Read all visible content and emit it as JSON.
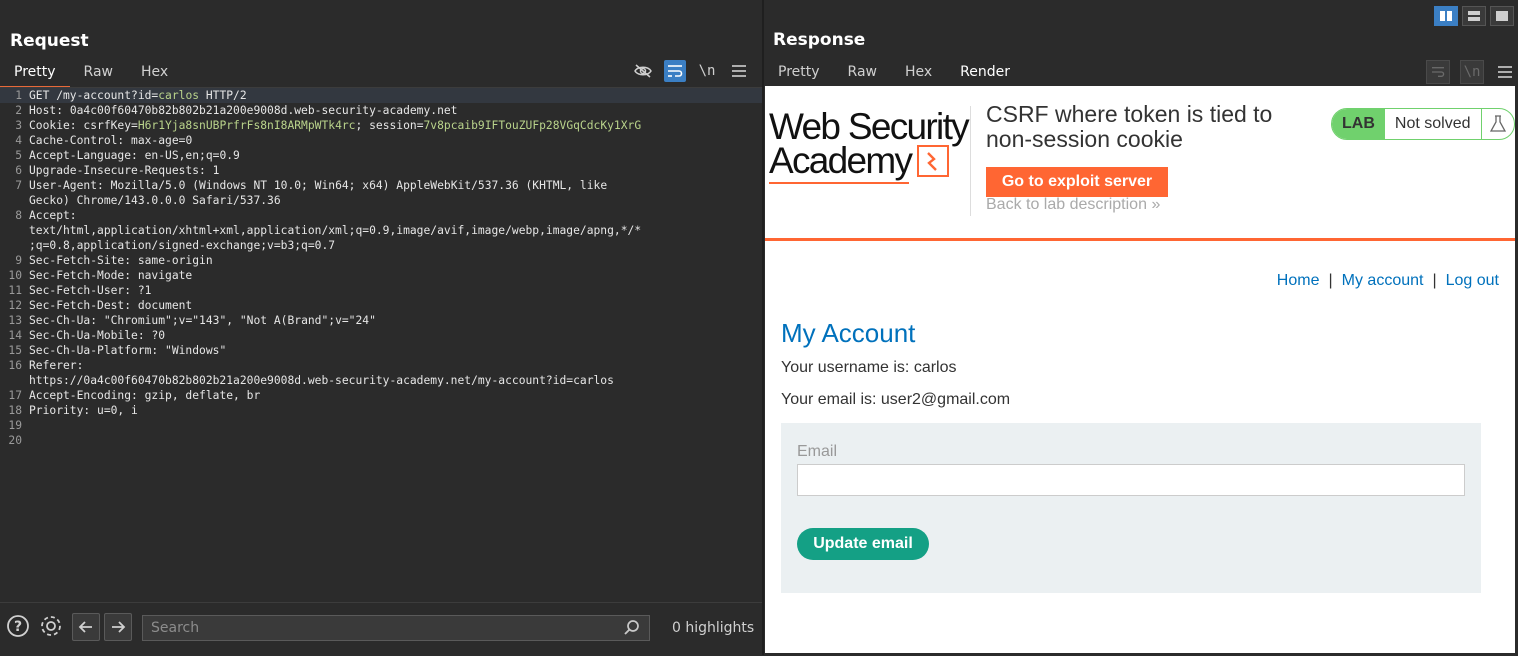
{
  "request": {
    "title": "Request",
    "tabs": [
      {
        "label": "Pretty",
        "active": true
      },
      {
        "label": "Raw",
        "active": false
      },
      {
        "label": "Hex",
        "active": false
      }
    ],
    "newline_label": "\\n",
    "lines": [
      {
        "n": "1",
        "k": "GET /my-account?id=",
        "v": "carlos",
        "r": " HTTP/2"
      },
      {
        "n": "2",
        "k": "Host: ",
        "v": "",
        "r": "0a4c00f60470b82b802b21a200e9008d.web-security-academy.net"
      },
      {
        "n": "3",
        "k": "Cookie: csrfKey=",
        "v": "H6r1Yja8snUBPrfrFs8nI8ARMpWTk4rc",
        "r": "; session=",
        "v2": "7v8pcaib9IFTouZUFp28VGqCdcKy1XrG"
      },
      {
        "n": "4",
        "k": "Cache-Control: ",
        "v": "",
        "r": "max-age=0"
      },
      {
        "n": "5",
        "k": "Accept-Language: ",
        "v": "",
        "r": "en-US,en;q=0.9"
      },
      {
        "n": "6",
        "k": "Upgrade-Insecure-Requests: ",
        "v": "",
        "r": "1"
      },
      {
        "n": "7",
        "k": "User-Agent: ",
        "v": "",
        "r": "Mozilla/5.0 (Windows NT 10.0; Win64; x64) AppleWebKit/537.36 (KHTML, like"
      },
      {
        "n": "",
        "k": "",
        "v": "",
        "r": "Gecko) Chrome/143.0.0.0 Safari/537.36"
      },
      {
        "n": "8",
        "k": "Accept: ",
        "v": "",
        "r": ""
      },
      {
        "n": "",
        "k": "",
        "v": "",
        "r": "text/html,application/xhtml+xml,application/xml;q=0.9,image/avif,image/webp,image/apng,*/*"
      },
      {
        "n": "",
        "k": "",
        "v": "",
        "r": ";q=0.8,application/signed-exchange;v=b3;q=0.7"
      },
      {
        "n": "9",
        "k": "Sec-Fetch-Site: ",
        "v": "",
        "r": "same-origin"
      },
      {
        "n": "10",
        "k": "Sec-Fetch-Mode: ",
        "v": "",
        "r": "navigate"
      },
      {
        "n": "11",
        "k": "Sec-Fetch-User: ",
        "v": "",
        "r": "?1"
      },
      {
        "n": "12",
        "k": "Sec-Fetch-Dest: ",
        "v": "",
        "r": "document"
      },
      {
        "n": "13",
        "k": "Sec-Ch-Ua: ",
        "v": "",
        "r": "\"Chromium\";v=\"143\", \"Not A(Brand\";v=\"24\""
      },
      {
        "n": "14",
        "k": "Sec-Ch-Ua-Mobile: ",
        "v": "",
        "r": "?0"
      },
      {
        "n": "15",
        "k": "Sec-Ch-Ua-Platform: ",
        "v": "",
        "r": "\"Windows\""
      },
      {
        "n": "16",
        "k": "Referer: ",
        "v": "",
        "r": ""
      },
      {
        "n": "",
        "k": "",
        "v": "",
        "r": "https://0a4c00f60470b82b802b21a200e9008d.web-security-academy.net/my-account?id=carlos"
      },
      {
        "n": "17",
        "k": "Accept-Encoding: ",
        "v": "",
        "r": "gzip, deflate, br"
      },
      {
        "n": "18",
        "k": "Priority: ",
        "v": "",
        "r": "u=0, i"
      },
      {
        "n": "19",
        "k": "",
        "v": "",
        "r": ""
      },
      {
        "n": "20",
        "k": "",
        "v": "",
        "r": ""
      }
    ],
    "search_placeholder": "Search",
    "highlights": "0 highlights"
  },
  "response": {
    "title": "Response",
    "tabs": [
      {
        "label": "Pretty",
        "active": false
      },
      {
        "label": "Raw",
        "active": false
      },
      {
        "label": "Hex",
        "active": false
      },
      {
        "label": "Render",
        "active": true
      }
    ],
    "newline_label": "\\n",
    "render": {
      "logo_line1": "Web Security",
      "logo_line2": "Academy",
      "lab_title": "CSRF where token is tied to non-session cookie",
      "exploit_button": "Go to exploit server",
      "back_link": "Back to lab description",
      "back_chevron": "»",
      "lab_label": "LAB",
      "lab_status": "Not solved",
      "nav": {
        "home": "Home",
        "my_account": "My account",
        "log_out": "Log out",
        "separator": "|"
      },
      "heading": "My Account",
      "username_line": "Your username is: carlos",
      "email_line": "Your email is: user2@gmail.com",
      "form_label": "Email",
      "email_value": "",
      "update_button": "Update email"
    }
  },
  "colors": {
    "accent_blue": "#3b7fc4",
    "tab_underline": "#e8693a",
    "academy_orange": "#ff6633",
    "link_blue": "#0071bc",
    "button_green": "#14a085",
    "lab_green": "#70d16d",
    "value_green": "#b9d38b"
  }
}
